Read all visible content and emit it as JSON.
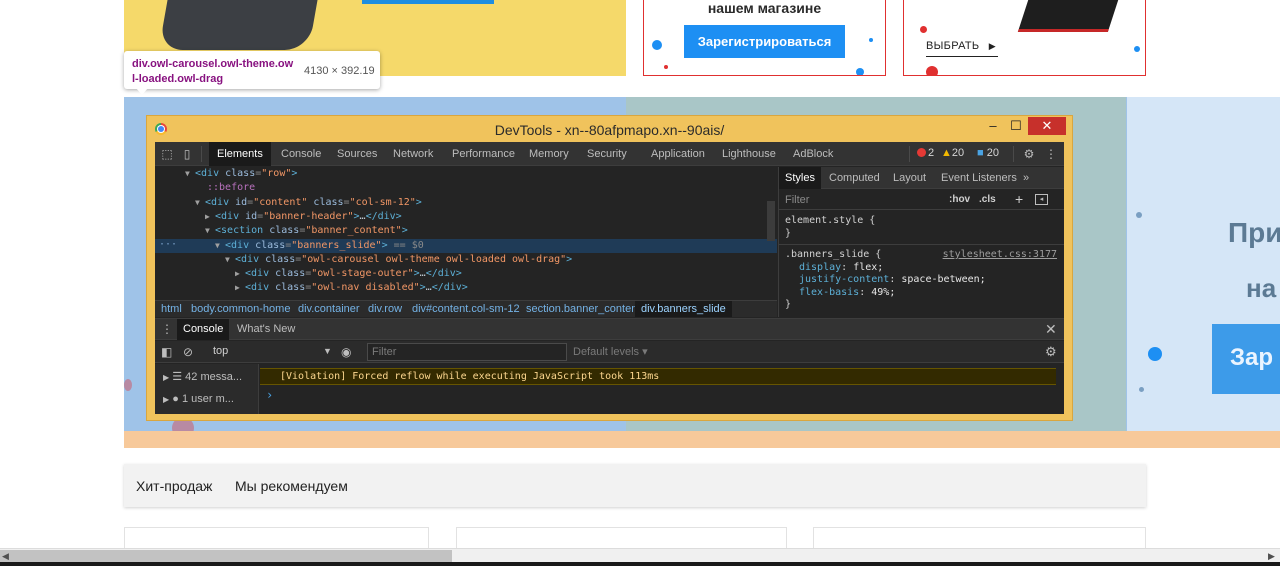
{
  "page": {
    "banner_mid_title": "нашем магазине",
    "register_button": "Зарегистрироваться",
    "choose_button": "ВЫБРАТЬ",
    "hero_right_text1": "При",
    "hero_right_text2": "на",
    "hero_right_button": "Зар",
    "tabs": [
      "Хит-продаж",
      "Мы рекомендуем"
    ]
  },
  "tooltip": {
    "selector": "div.owl-carousel.owl-theme.ow",
    "selector_line2": "l-loaded.owl-drag",
    "dimensions": "4130 × 392.19"
  },
  "devtools": {
    "window_title": "DevTools - xn--80afpmapo.xn--90ais/",
    "minimize": "–",
    "maximize": "☐",
    "close": "✕",
    "panel_tabs": [
      "Elements",
      "Console",
      "Sources",
      "Network",
      "Performance",
      "Memory",
      "Security",
      "Application",
      "Lighthouse",
      "AdBlock"
    ],
    "active_panel": "Elements",
    "errors": "2",
    "warnings": "20",
    "infos": "20",
    "dom": {
      "row_tag": "div",
      "row_attr": "class",
      "row_val": "\"row\"",
      "before": "::before",
      "content_tag": "div",
      "content_attr1": "id",
      "content_val1": "\"content\"",
      "content_attr2": "class",
      "content_val2": "\"col-sm-12\"",
      "header_tag": "div",
      "header_attr": "id",
      "header_val": "\"banner-header\"",
      "section_tag": "section",
      "section_attr": "class",
      "section_val": "\"banner_content\"",
      "slide_tag": "div",
      "slide_attr": "class",
      "slide_val": "\"banners_slide\"",
      "slide_ref": "== $0",
      "carousel_tag": "div",
      "carousel_attr": "class",
      "carousel_val": "\"owl-carousel owl-theme owl-loaded owl-drag\"",
      "stage_tag": "div",
      "stage_attr": "class",
      "stage_val": "\"owl-stage-outer\"",
      "nav_tag": "div",
      "nav_attr": "class",
      "nav_val": "\"owl-nav disabled\"",
      "ellipsis": "…"
    },
    "breadcrumbs": [
      "html",
      "body.common-home",
      "div.container",
      "div.row",
      "div#content.col-sm-12",
      "section.banner_content",
      "div.banners_slide"
    ],
    "styles": {
      "tabs": [
        "Styles",
        "Computed",
        "Layout",
        "Event Listeners"
      ],
      "more": "»",
      "filter_placeholder": "Filter",
      "hov": ":hov",
      "cls": ".cls",
      "element_style": "element.style {",
      "close_brace": "}",
      "rule_selector": ".banners_slide {",
      "rule_source": "stylesheet.css:3177",
      "props": [
        {
          "name": "display",
          "value": "flex;"
        },
        {
          "name": "justify-content",
          "value": "space-between;"
        },
        {
          "name": "flex-basis",
          "value": "49%;"
        }
      ]
    },
    "drawer": {
      "tabs": [
        "Console",
        "What's New"
      ],
      "context": "top",
      "filter_placeholder": "Filter",
      "levels": "Default levels ▾",
      "sidebar": [
        "42 messa...",
        "1 user m..."
      ],
      "violation": "[Violation] Forced reflow while executing JavaScript took 113ms",
      "prompt": "›"
    }
  }
}
